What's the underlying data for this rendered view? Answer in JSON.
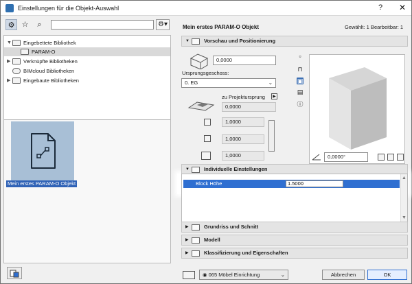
{
  "window": {
    "title": "Einstellungen für die Objekt-Auswahl",
    "help_label": "?",
    "close_label": "✕"
  },
  "left": {
    "tree": [
      {
        "label": "Eingebettete Bibliothek",
        "expanded": true,
        "level": 0
      },
      {
        "label": "PARAM-O",
        "selected": true,
        "level": 1
      },
      {
        "label": "Verknüpfte Bibliotheken",
        "expanded": false,
        "level": 0
      },
      {
        "label": "BIMcloud Bibliotheken",
        "level": 0
      },
      {
        "label": "Eingebaute Bibliotheken",
        "expanded": false,
        "level": 0
      }
    ],
    "selected_object": "Mein erstes PARAM-O Objekt",
    "search_placeholder": ""
  },
  "right": {
    "object_name": "Mein erstes PARAM-O Objekt",
    "selection_info": "Gewählt: 1 Bearbeitbar: 1",
    "section_preview": "Vorschau und Positionierung",
    "elevation_value": "0,0000",
    "origin_story_label": "Ursprungsgeschoss:",
    "origin_story_value": "0. EG",
    "project_origin_label": "zu Projektursprung",
    "project_origin_value": "0,0000",
    "size_x": "1,0000",
    "size_y": "1,0000",
    "size_z": "1,0000",
    "angle_value": "0,0000°",
    "section_custom": "Individuelle Einstellungen",
    "param_name": "Block Höhe",
    "param_value": "1.5000",
    "section_floorplan": "Grundriss und Schnitt",
    "section_model": "Modell",
    "section_classification": "Klassifizierung und Eigenschaften",
    "layer_value": "065 Möbel Einrichtung",
    "cancel_label": "Abbrechen",
    "ok_label": "OK"
  },
  "colors": {
    "accent": "#2f6fd1",
    "selection": "#2f62b6",
    "tile": "#a8bfd6"
  }
}
